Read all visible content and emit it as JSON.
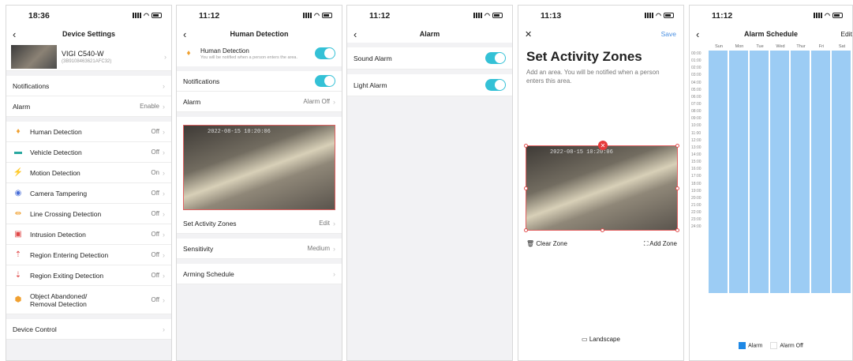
{
  "screen1": {
    "time": "18:36",
    "title": "Device Settings",
    "device_name": "VIGI C540-W",
    "device_id": "(3B9108463621AFC32)",
    "rows_top": [
      "Notifications"
    ],
    "alarm": {
      "label": "Alarm",
      "value": "Enable"
    },
    "detections": [
      {
        "label": "Human Detection",
        "value": "Off",
        "icon": "person-icon"
      },
      {
        "label": "Vehicle Detection",
        "value": "Off",
        "icon": "car-icon"
      },
      {
        "label": "Motion Detection",
        "value": "On",
        "icon": "running-person-icon"
      },
      {
        "label": "Camera Tampering",
        "value": "Off",
        "icon": "tamper-icon"
      },
      {
        "label": "Line Crossing Detection",
        "value": "Off",
        "icon": "line-crossing-icon"
      },
      {
        "label": "Intrusion Detection",
        "value": "Off",
        "icon": "intrusion-icon"
      },
      {
        "label": "Region Entering Detection",
        "value": "Off",
        "icon": "region-enter-icon"
      },
      {
        "label": "Region Exiting Detection",
        "value": "Off",
        "icon": "region-exit-icon"
      }
    ],
    "object_label_1": "Object Abandoned/",
    "object_label_2": "Removal Detection",
    "object_value": "Off",
    "device_control": "Device Control"
  },
  "screen2": {
    "time": "11:12",
    "title": "Human Detection",
    "hd_title": "Human Detection",
    "hd_sub": "You will be notified when a person enters the area.",
    "notifications": "Notifications",
    "alarm": "Alarm",
    "alarm_value": "Alarm Off",
    "timestamp": "2022-08-15  10:20:06",
    "zones_label": "Set Activity Zones",
    "zones_value": "Edit",
    "sensitivity": "Sensitivity",
    "sensitivity_value": "Medium",
    "arming": "Arming Schedule"
  },
  "screen3": {
    "time": "11:12",
    "title": "Alarm",
    "sound": "Sound Alarm",
    "light": "Light Alarm"
  },
  "screen4": {
    "time": "11:13",
    "save": "Save",
    "heading": "Set Activity Zones",
    "desc": "Add an area. You will be notified when a person enters this area.",
    "timestamp": "2022-08-15  10:20:06",
    "clear": "Clear Zone",
    "add": "Add Zone",
    "landscape": "Landscape"
  },
  "screen5": {
    "time": "11:12",
    "title": "Alarm Schedule",
    "edit": "Edit",
    "days": [
      "Sun",
      "Mon",
      "Tue",
      "Wed",
      "Thur",
      "Fri",
      "Sat"
    ],
    "hours": [
      "00:00",
      "01:00",
      "02:00",
      "03:00",
      "04:00",
      "05:00",
      "06:00",
      "07:00",
      "08:00",
      "09:00",
      "10:00",
      "11:00",
      "12:00",
      "13:00",
      "14:00",
      "15:00",
      "16:00",
      "17:00",
      "18:00",
      "19:00",
      "20:00",
      "21:00",
      "22:00",
      "23:00",
      "24:00"
    ],
    "legend_alarm": "Alarm",
    "legend_off": "Alarm Off",
    "alarm_color": "#1e88e5",
    "cell_color": "#9cccf4"
  }
}
